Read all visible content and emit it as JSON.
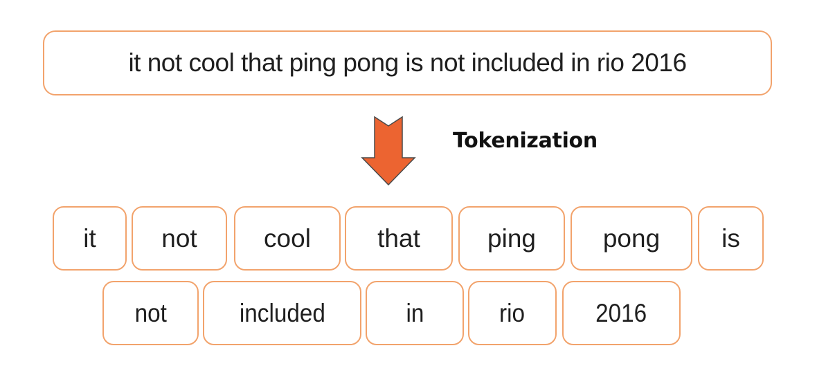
{
  "input_sentence": "it not cool that ping pong is not included in rio 2016",
  "step_label": "Tokenization",
  "arrow_icon": "down-arrow-icon",
  "colors": {
    "box_border": "#f2a36c",
    "arrow_fill": "#ec6431",
    "arrow_stroke": "#4a4a4a",
    "text": "#1f1f1f"
  },
  "tokens_row1": [
    "it",
    "not",
    "cool",
    "that",
    "ping",
    "pong",
    "is"
  ],
  "tokens_row2": [
    "not",
    "included",
    "in",
    "rio",
    "2016"
  ]
}
